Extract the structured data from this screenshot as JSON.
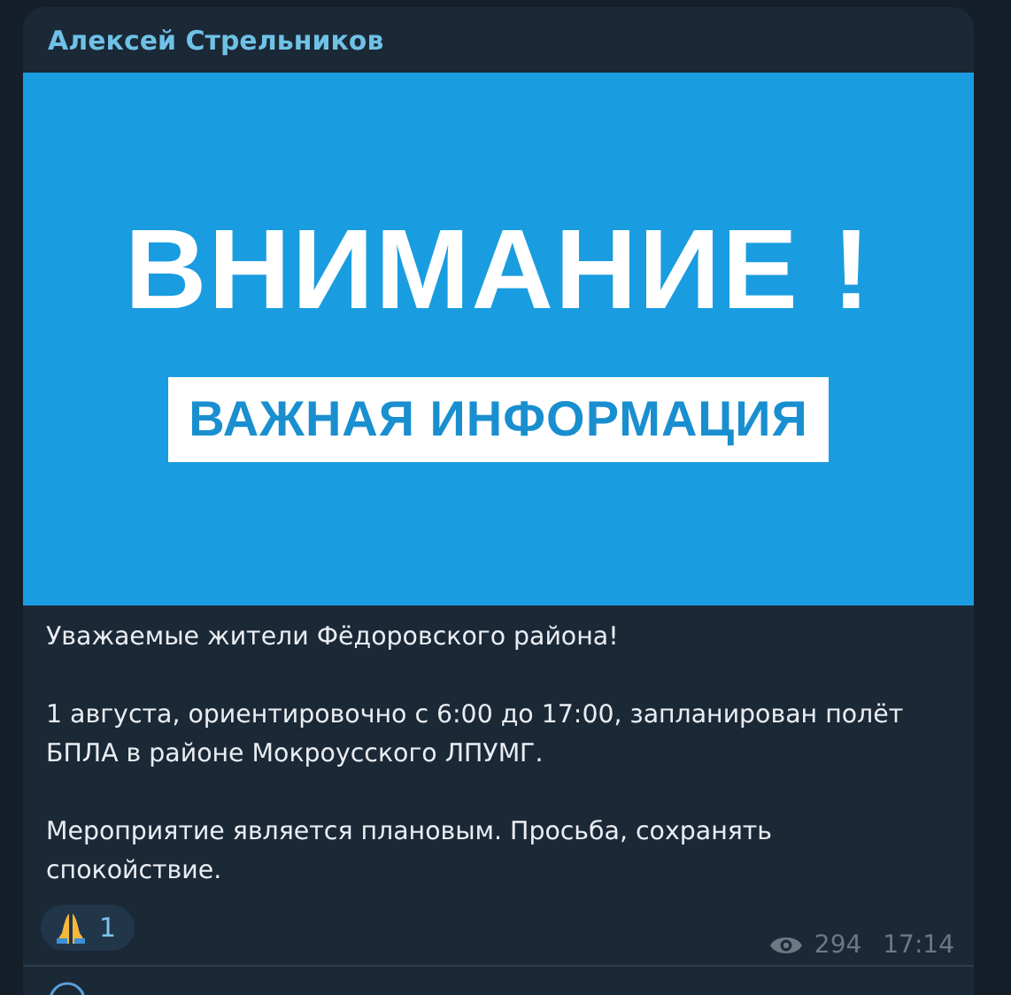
{
  "post": {
    "author": "Алексей Стрельников",
    "banner": {
      "headline": "ВНИМАНИЕ !",
      "subheadline": "ВАЖНАЯ ИНФОРМАЦИЯ"
    },
    "paragraphs": [
      "Уважаемые жители Фёдоровского района!",
      "1 августа, ориентировочно с 6:00 до 17:00, запланирован полёт БПЛА в районе Мокроусского ЛПУМГ.",
      "Мероприятие является плановым. Просьба, сохранять спокойствие."
    ],
    "reactions": [
      {
        "count": "1"
      }
    ],
    "views": "294",
    "time": "17:14"
  }
}
